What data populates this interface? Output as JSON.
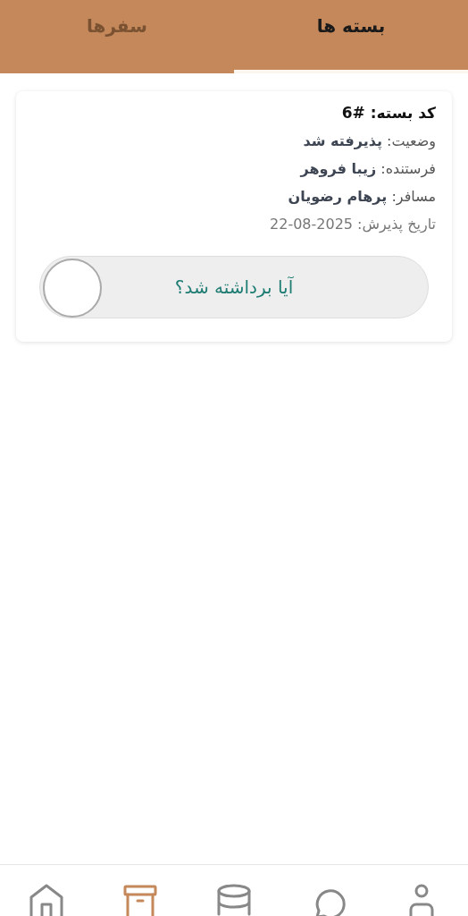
{
  "tabs": [
    {
      "label": "بسته ها",
      "selected": true
    },
    {
      "label": "سفرها",
      "selected": false
    }
  ],
  "card": {
    "lines": [
      {
        "kind": "title",
        "text": "کد بسته: #6"
      },
      {
        "kind": "field",
        "text": "وضعیت: **پذیرفته شد**"
      },
      {
        "kind": "field",
        "text": "فرستنده: **زیبا فروهر**"
      },
      {
        "kind": "field",
        "text": "مسافر: **پرهام رضویان**"
      },
      {
        "kind": "date",
        "label": "تاریخ پذیرش:",
        "value": "22-08-2025"
      }
    ],
    "pickup_toggle": {
      "label": "آیا برداشته شد؟",
      "checked": false
    }
  },
  "bottom_nav": [
    {
      "kind": "profile",
      "selected": false
    },
    {
      "kind": "chat",
      "selected": false
    },
    {
      "kind": "database",
      "selected": false
    },
    {
      "kind": "box",
      "selected": true
    },
    {
      "kind": "home",
      "selected": false
    }
  ]
}
